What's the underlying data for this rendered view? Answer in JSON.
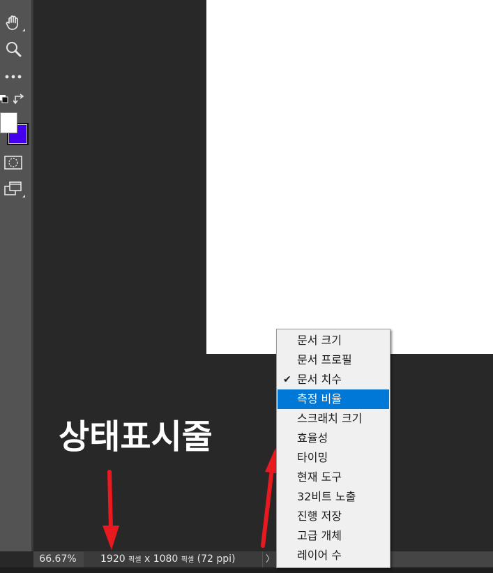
{
  "toolbar": {
    "tools": [
      {
        "icon": "hand-icon",
        "has_flyout": true
      },
      {
        "icon": "zoom-icon",
        "has_flyout": false
      },
      {
        "icon": "more-tools-icon",
        "has_flyout": false
      },
      {
        "icon": "default-colors-icon",
        "has_flyout": false
      },
      {
        "icon": "quick-mask-icon",
        "has_flyout": false
      },
      {
        "icon": "screen-mode-icon",
        "has_flyout": true
      }
    ],
    "foreground_color": "#ffffff",
    "background_color": "#4400ee"
  },
  "status_bar": {
    "zoom": "66.67%",
    "doc_info": {
      "width": "1920",
      "width_unit": "픽셀",
      "x": "x",
      "height": "1080",
      "height_unit": "픽셀",
      "resolution": "(72 ppi)"
    },
    "arrow": "〉"
  },
  "annotation": {
    "label": "상태표시줄",
    "arrow_color": "#e8191f"
  },
  "menu": {
    "items": [
      {
        "label": "문서 크기",
        "checked": false,
        "highlighted": false
      },
      {
        "label": "문서 프로필",
        "checked": false,
        "highlighted": false
      },
      {
        "label": "문서 치수",
        "checked": true,
        "highlighted": false
      },
      {
        "label": "측정 비율",
        "checked": false,
        "highlighted": true
      },
      {
        "label": "스크래치 크기",
        "checked": false,
        "highlighted": false
      },
      {
        "label": "효율성",
        "checked": false,
        "highlighted": false
      },
      {
        "label": "타이밍",
        "checked": false,
        "highlighted": false
      },
      {
        "label": "현재 도구",
        "checked": false,
        "highlighted": false
      },
      {
        "label": "32비트 노출",
        "checked": false,
        "highlighted": false
      },
      {
        "label": "진행 저장",
        "checked": false,
        "highlighted": false
      },
      {
        "label": "고급 개체",
        "checked": false,
        "highlighted": false
      },
      {
        "label": "레이어 수",
        "checked": false,
        "highlighted": false
      }
    ],
    "highlight_color": "#0078d7",
    "check_glyph": "✔"
  }
}
